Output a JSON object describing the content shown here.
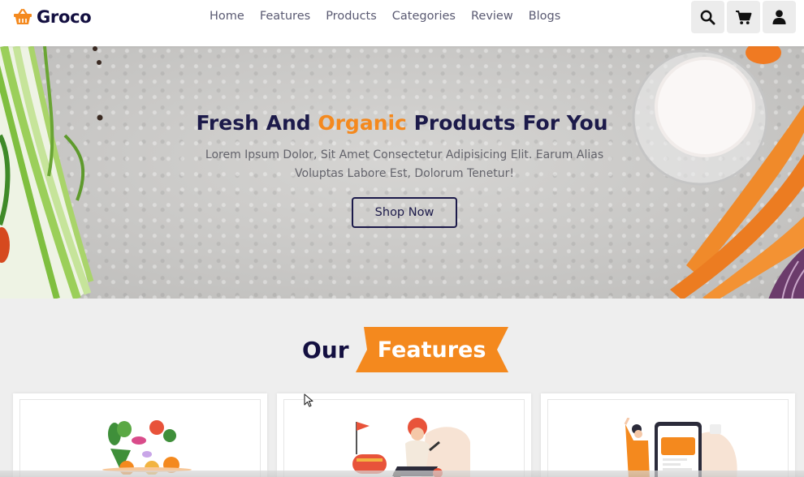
{
  "brand": {
    "name": "Groco",
    "accent_color": "#f4891e",
    "dark_color": "#130f40"
  },
  "nav": {
    "items": [
      {
        "label": "Home"
      },
      {
        "label": "Features"
      },
      {
        "label": "Products"
      },
      {
        "label": "Categories"
      },
      {
        "label": "Review"
      },
      {
        "label": "Blogs"
      }
    ]
  },
  "header_icons": [
    "search-icon",
    "cart-icon",
    "user-icon"
  ],
  "hero": {
    "title_start": "Fresh And ",
    "title_accent": "Organic",
    "title_end": " Products For You",
    "subtitle": "Lorem Ipsum Dolor, Sit Amet Consectetur Adipisicing Elit. Earum Alias Voluptas Labore Est, Dolorum Tenetur!",
    "button_label": "Shop Now"
  },
  "features": {
    "heading_plain": "Our",
    "heading_highlight": "Features"
  }
}
